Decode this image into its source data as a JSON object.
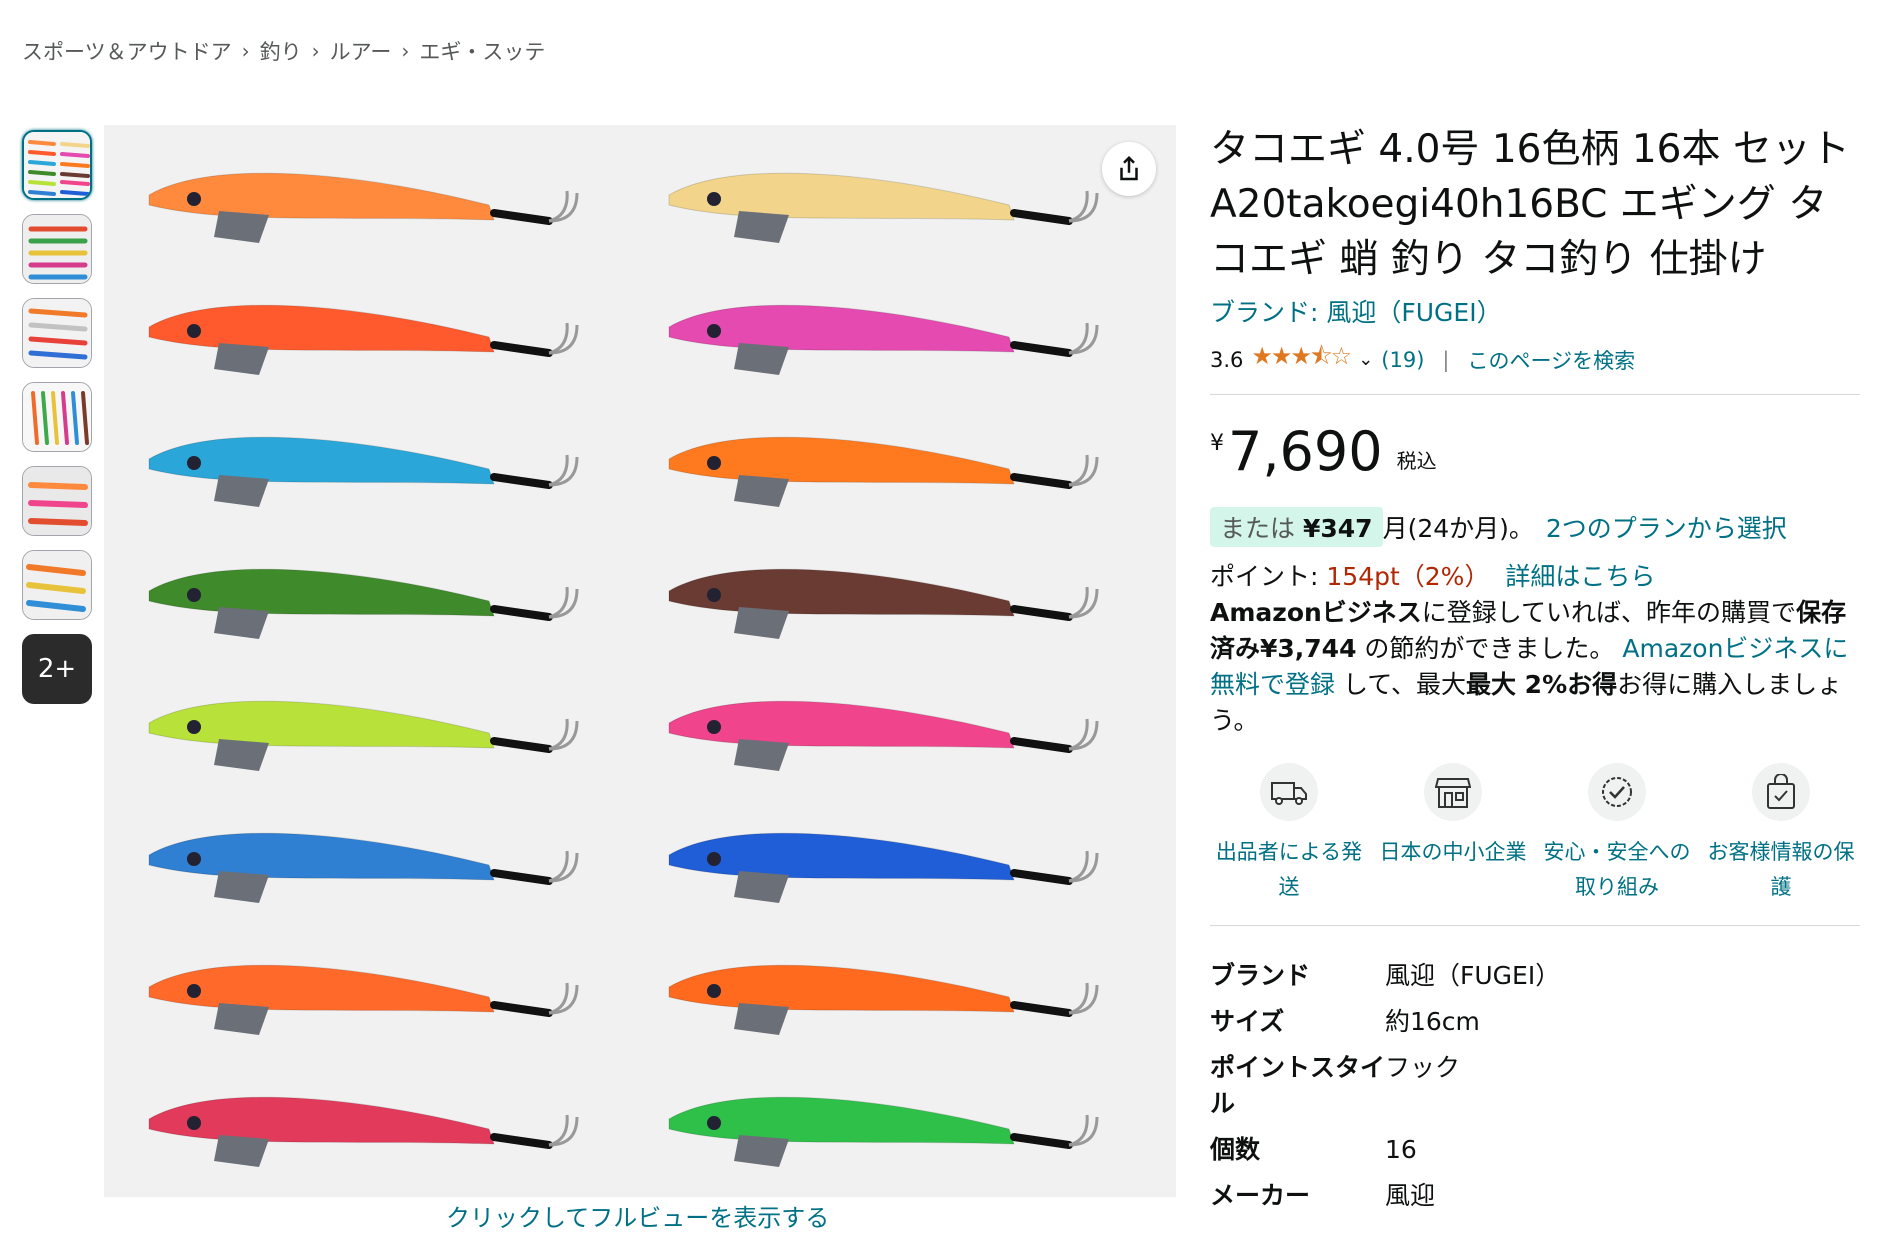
{
  "breadcrumb": [
    "スポーツ＆アウトドア",
    "釣り",
    "ルアー",
    "エギ・スッテ"
  ],
  "gallery": {
    "more_label": "2+",
    "fullview_label": "クリックしてフルビューを表示する"
  },
  "product": {
    "title": "タコエギ 4.0号 16色柄 16本 セット A20takoegi40h16BC エギング タコエギ 蛸 釣り タコ釣り 仕掛け",
    "brand_link": "ブランド: 風迎（FUGEI）",
    "rating_value": "3.6",
    "rating_stars": 3.6,
    "rating_count": "(19)",
    "search_page": "このページを検索",
    "price_symbol": "¥",
    "price_amount": "7,690",
    "price_tax": "税込",
    "installment_prefix": "または",
    "installment_amount": "¥347",
    "installment_suffix": "月(24か月)。",
    "installment_plan": "2つのプランから選択",
    "points_label": "ポイント:",
    "points_value": "154pt（2%）",
    "points_detail": "詳細はこちら",
    "biz_bold1": "Amazonビジネス",
    "biz_text1": "に登録していれば、昨年の購買で",
    "biz_bold2": "保存済み¥3,744",
    "biz_text2": " の節約ができました。",
    "biz_link": "Amazonビジネスに無料で登録",
    "biz_text3": " して、最大",
    "biz_bold3": "最大 2%お得",
    "biz_text4": "お得に購入しましょう。"
  },
  "badges": [
    {
      "icon": "truck-icon",
      "label": "出品者による発送"
    },
    {
      "icon": "store-icon",
      "label": "日本の中小企業"
    },
    {
      "icon": "shield-check-icon",
      "label": "安心・安全への取り組み"
    },
    {
      "icon": "lock-bag-icon",
      "label": "お客様情報の保護"
    }
  ],
  "specs": [
    {
      "key": "ブランド",
      "value": "風迎（FUGEI）"
    },
    {
      "key": "サイズ",
      "value": "約16cm"
    },
    {
      "key": "ポイントスタイル",
      "value": "フック"
    },
    {
      "key": "個数",
      "value": "16"
    },
    {
      "key": "メーカー",
      "value": "風迎"
    }
  ],
  "colors": {
    "link": "#007185",
    "star": "#de7921",
    "price_red": "#b12704",
    "badge_bg": "#d4f5e9"
  }
}
